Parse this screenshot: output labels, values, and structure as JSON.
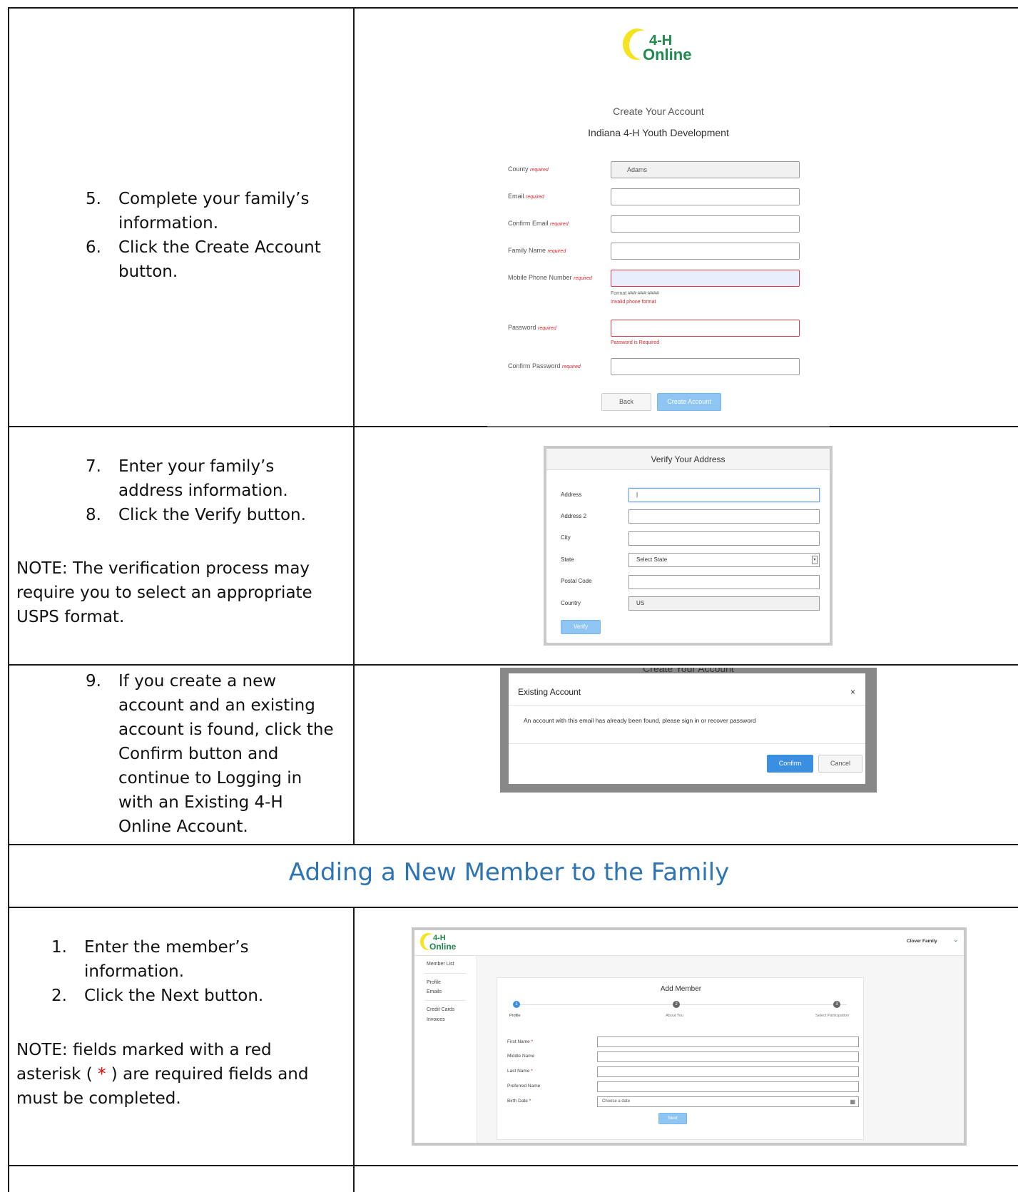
{
  "rows": {
    "row1": {
      "steps": [
        {
          "num": "5.",
          "text_lines": [
            "Complete your family’s",
            "information."
          ]
        },
        {
          "num": "6.",
          "text_lines": [
            "Click the Create Account",
            "button."
          ]
        }
      ]
    },
    "row2": {
      "steps": [
        {
          "num": "7.",
          "text_lines": [
            "Enter your family’s",
            "address information."
          ]
        },
        {
          "num": "8.",
          "text_lines": [
            "Click the Verify button."
          ]
        }
      ],
      "note_lines": [
        "NOTE:  The verification process may",
        "require you to select an appropriate",
        "USPS format."
      ]
    },
    "row3": {
      "steps": [
        {
          "num": "9.",
          "text_lines": [
            "If you create a new",
            "account and an existing",
            "account is found, click the",
            "Confirm button and",
            "continue to Logging in",
            "with an Existing 4-H",
            "Online Account."
          ]
        }
      ]
    },
    "section_title": "Adding a New Member to the Family",
    "row4": {
      "steps": [
        {
          "num": "1.",
          "text_lines": [
            "Enter the member’s",
            "information."
          ]
        },
        {
          "num": "2.",
          "text_lines": [
            "Click the Next button."
          ]
        }
      ],
      "note_lines": [
        "NOTE: fields marked with a red",
        "asterisk ( ",
        "*",
        " ) are required fields and",
        "must be completed."
      ]
    }
  },
  "logo": {
    "top": "4-H",
    "bottom": "Online",
    "colors": {
      "moon": "#f4e31e",
      "text": "#1f8a4c"
    }
  },
  "create_account": {
    "title": "Create Your Account",
    "subtitle": "Indiana 4-H Youth Development",
    "required_word": "required",
    "fields": [
      {
        "label": "County",
        "value": "Adams"
      },
      {
        "label": "Email",
        "value": ""
      },
      {
        "label": "Confirm Email",
        "value": ""
      },
      {
        "label": "Family Name",
        "value": ""
      },
      {
        "label": "Mobile Phone Number",
        "value": "",
        "help": "Format ###-###-####",
        "error": "Invalid phone format"
      },
      {
        "label": "Password",
        "value": "",
        "error": "Password is Required"
      },
      {
        "label": "Confirm Password",
        "value": ""
      }
    ],
    "back_label": "Back",
    "create_label": "Create Account"
  },
  "verify_address": {
    "title": "Verify Your Address",
    "fields": [
      {
        "label": "Address",
        "value": "|"
      },
      {
        "label": "Address 2",
        "value": ""
      },
      {
        "label": "City",
        "value": ""
      },
      {
        "label": "State",
        "value": "Select State"
      },
      {
        "label": "Postal Code",
        "value": ""
      },
      {
        "label": "Country",
        "value": "US"
      }
    ],
    "verify_label": "Verify"
  },
  "existing_account": {
    "behind_title": "Create Your Account",
    "title": "Existing Account",
    "close": "×",
    "message": "An account with this email has already been found, please sign in or recover password",
    "confirm_label": "Confirm",
    "cancel_label": "Cancel"
  },
  "add_member": {
    "user": "Clover Family",
    "nav": [
      "Member List",
      "Profile",
      "Emails",
      "Credit Cards",
      "Invoices"
    ],
    "title": "Add Member",
    "steps": [
      {
        "num": "1",
        "label": "Profile"
      },
      {
        "num": "2",
        "label": "About You"
      },
      {
        "num": "3",
        "label": "Select Participation"
      }
    ],
    "fields": [
      {
        "label": "First Name",
        "req": "*",
        "value": ""
      },
      {
        "label": "Middle Name",
        "req": "",
        "value": ""
      },
      {
        "label": "Last Name",
        "req": "*",
        "value": ""
      },
      {
        "label": "Preferred Name",
        "req": "",
        "value": ""
      },
      {
        "label": "Birth Date",
        "req": "*",
        "value": "Choose a date"
      }
    ],
    "next_label": "Next"
  }
}
